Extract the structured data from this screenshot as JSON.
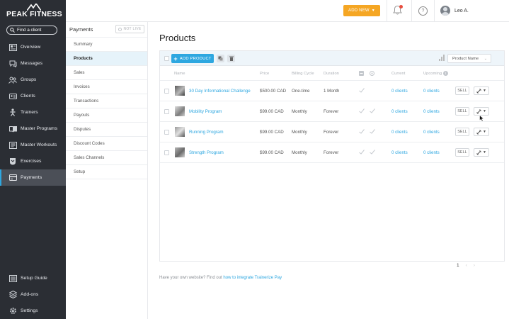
{
  "brand": {
    "name": "PEAK FITNESS"
  },
  "search": {
    "placeholder": "Find a client"
  },
  "sidebar": {
    "items": [
      {
        "label": "Overview",
        "icon": "overview-icon"
      },
      {
        "label": "Messages",
        "icon": "messages-icon"
      },
      {
        "label": "Groups",
        "icon": "groups-icon"
      },
      {
        "label": "Clients",
        "icon": "clients-icon"
      },
      {
        "label": "Trainers",
        "icon": "trainers-icon"
      },
      {
        "label": "Master Programs",
        "icon": "programs-icon"
      },
      {
        "label": "Master Workouts",
        "icon": "workouts-icon"
      },
      {
        "label": "Exercises",
        "icon": "exercises-icon"
      },
      {
        "label": "Payments",
        "icon": "payments-icon",
        "active": true
      }
    ],
    "bottom": [
      {
        "label": "Setup Guide",
        "icon": "setup-guide-icon"
      },
      {
        "label": "Add-ons",
        "icon": "add-ons-icon"
      },
      {
        "label": "Settings",
        "icon": "settings-icon"
      }
    ]
  },
  "topbar": {
    "add_new_label": "ADD NEW",
    "help_label": "?",
    "user_name": "Leo A."
  },
  "subnav": {
    "title": "Payments",
    "status_badge": "NOT LIVE",
    "items": [
      "Summary",
      "Products",
      "Sales",
      "Invoices",
      "Transactions",
      "Payouts",
      "Disputes",
      "Discount Codes",
      "Sales Channels",
      "Setup"
    ],
    "active": "Products"
  },
  "main": {
    "title": "Products",
    "add_product_label": "ADD PRODUCT",
    "sort_select": "Product Name",
    "columns": {
      "name": "Name",
      "price": "Price",
      "billing": "Billing Cycle",
      "duration": "Duration",
      "current": "Current",
      "upcoming": "Upcoming"
    },
    "rows": [
      {
        "name": "30 Day Informational Challenge",
        "price": "$500.00 CAD",
        "billing": "One-time",
        "duration": "1 Month",
        "current": "0 clients",
        "upcoming": "0 clients",
        "sell": "SELL"
      },
      {
        "name": "Mobility Program",
        "price": "$99.00 CAD",
        "billing": "Monthly",
        "duration": "Forever",
        "current": "0 clients",
        "upcoming": "0 clients",
        "sell": "SELL"
      },
      {
        "name": "Running Program",
        "price": "$99.00 CAD",
        "billing": "Monthly",
        "duration": "Forever",
        "current": "0 clients",
        "upcoming": "0 clients",
        "sell": "SELL"
      },
      {
        "name": "Strength Program",
        "price": "$99.00 CAD",
        "billing": "Monthly",
        "duration": "Forever",
        "current": "0 clients",
        "upcoming": "0 clients",
        "sell": "SELL"
      }
    ],
    "pagination": {
      "current_page": "1",
      "prev": "‹",
      "next": "›"
    },
    "footnote": {
      "text": "Have your own website? Find out ",
      "link": "how to integrate Trainerize Pay"
    }
  },
  "colors": {
    "accent": "#2ea7e0",
    "add_new": "#f5a623",
    "sidebar_bg": "#2b2e34",
    "alert": "#e84c3d"
  }
}
